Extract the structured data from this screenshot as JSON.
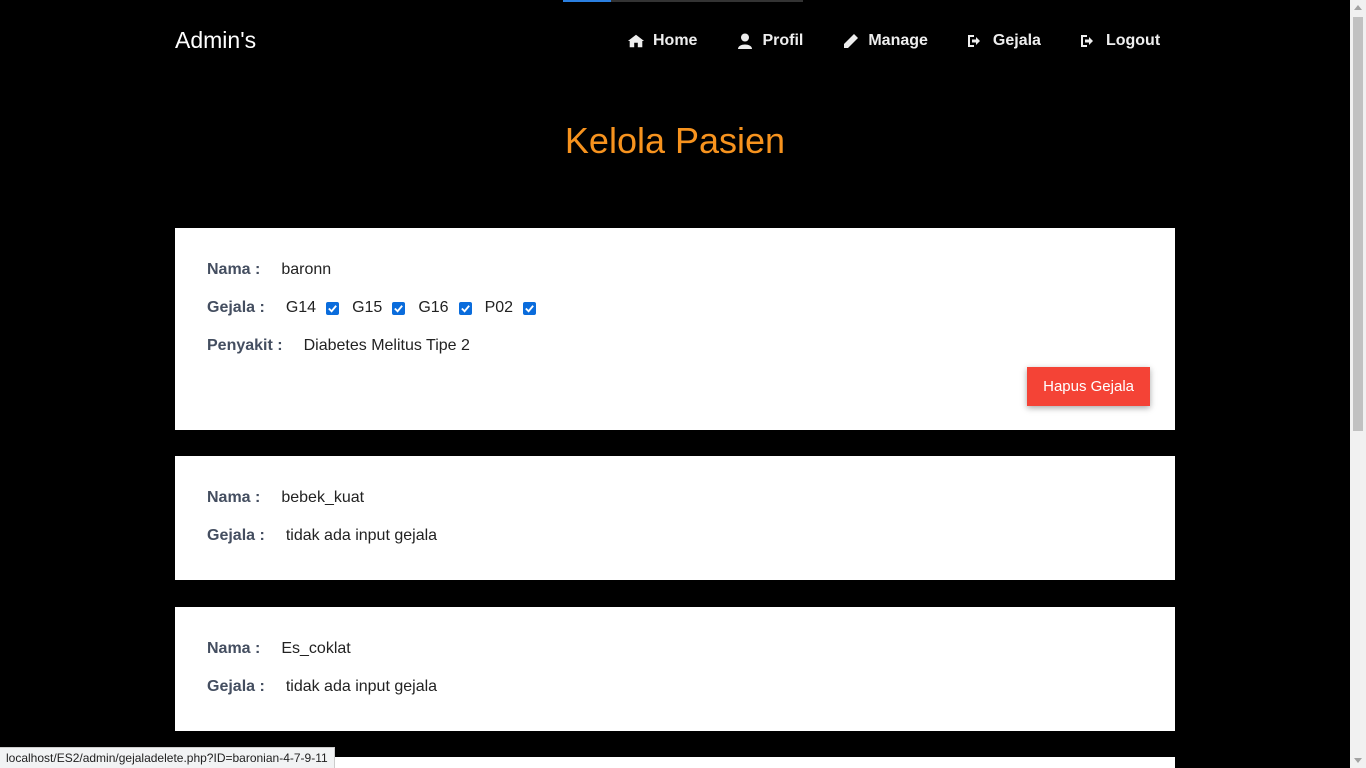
{
  "nav": {
    "brand": "Admin's",
    "items": [
      {
        "label": "Home",
        "icon": "home-icon"
      },
      {
        "label": "Profil",
        "icon": "user-icon"
      },
      {
        "label": "Manage",
        "icon": "pencil-icon"
      },
      {
        "label": "Gejala",
        "icon": "sign-out-icon"
      },
      {
        "label": "Logout",
        "icon": "sign-out-icon"
      }
    ]
  },
  "page": {
    "title": "Kelola Pasien"
  },
  "labels": {
    "nama": "Nama :",
    "gejala": "Gejala :",
    "penyakit": "Penyakit :"
  },
  "patients": [
    {
      "nama": "baronn",
      "gejala": [
        "G14",
        "G15",
        "G16",
        "P02"
      ],
      "penyakit": "Diabetes Melitus Tipe 2",
      "button": "Hapus Gejala"
    },
    {
      "nama": "bebek_kuat",
      "gejala_text": "tidak ada input gejala"
    },
    {
      "nama": "Es_coklat",
      "gejala_text": "tidak ada input gejala"
    }
  ],
  "status_bar": {
    "url": "localhost/ES2/admin/gejaladelete.php?ID=baronian-4-7-9-11"
  },
  "colors": {
    "accent": "#f7931e",
    "danger": "#f44336",
    "checkbox": "#0a6cdc"
  }
}
